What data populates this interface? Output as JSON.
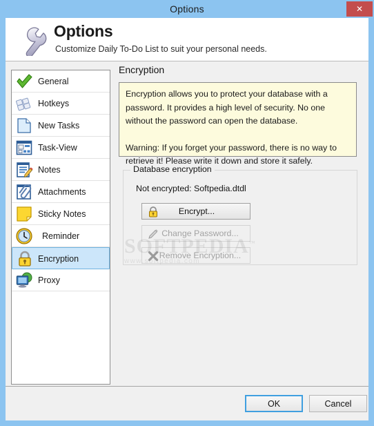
{
  "window": {
    "title": "Options",
    "close_label": "✕",
    "titlebar_color": "#8cc4f0",
    "close_color": "#c34d4d"
  },
  "header": {
    "title": "Options",
    "subtitle": "Customize Daily To-Do List to suit your personal needs.",
    "icon": "wrench-icon"
  },
  "sidebar": {
    "selected": "Encryption",
    "items": [
      {
        "label": "General",
        "icon": "green-check-icon"
      },
      {
        "label": "Hotkeys",
        "icon": "keyboard-keys-icon"
      },
      {
        "label": "New Tasks",
        "icon": "blank-page-icon"
      },
      {
        "label": "Task-View",
        "icon": "task-list-icon"
      },
      {
        "label": "Notes",
        "icon": "notes-pencil-icon"
      },
      {
        "label": "Attachments",
        "icon": "paperclip-icon"
      },
      {
        "label": "Sticky Notes",
        "icon": "yellow-sticky-note-icon"
      },
      {
        "label": "Reminder",
        "icon": "clock-icon"
      },
      {
        "label": "Encryption",
        "icon": "padlock-icon"
      },
      {
        "label": "Proxy",
        "icon": "monitor-globe-icon"
      }
    ]
  },
  "pane": {
    "title": "Encryption",
    "info_paragraph_1": "Encryption allows you to protect your database with a password. It provides a high level of security. No one without the password can open the database.",
    "info_paragraph_2": "Warning: If you forget your password, there is no way to retrieve it! Please write it down and store it safely.",
    "group": {
      "legend": "Database encryption",
      "status": "Not encrypted: Softpedia.dtdl",
      "buttons": [
        {
          "label": "Encrypt...",
          "icon": "padlock-icon",
          "enabled": true
        },
        {
          "label": "Change Password...",
          "icon": "pencil-icon",
          "enabled": false
        },
        {
          "label": "Remove Encryption...",
          "icon": "x-mark-icon",
          "enabled": false
        }
      ]
    }
  },
  "watermark": {
    "main": "SOFTPEDIA",
    "trademark": "™",
    "sub": "www.softpedia.com"
  },
  "footer": {
    "ok_label": "OK",
    "cancel_label": "Cancel"
  }
}
